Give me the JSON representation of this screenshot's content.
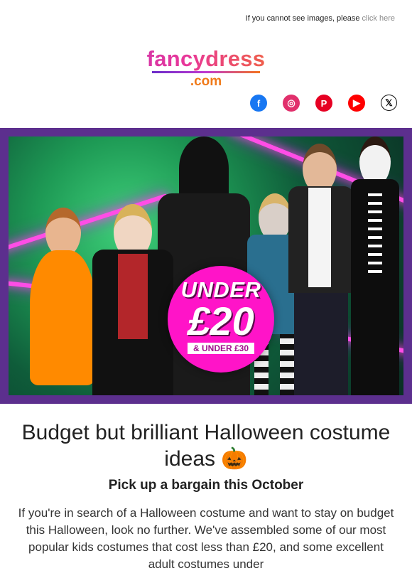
{
  "preheader": {
    "text": "If you cannot see images, please",
    "link": "click here"
  },
  "logo": {
    "main": "fancydress",
    "sub": ".com"
  },
  "social": [
    {
      "name": "facebook",
      "glyph": "f"
    },
    {
      "name": "instagram",
      "glyph": "◎"
    },
    {
      "name": "pinterest",
      "glyph": "P"
    },
    {
      "name": "youtube",
      "glyph": "▶"
    },
    {
      "name": "x",
      "glyph": "𝕏"
    }
  ],
  "hero": {
    "badge_line1": "UNDER",
    "badge_line2": "£20",
    "badge_line3": "& UNDER £30"
  },
  "content": {
    "headline": "Budget but brilliant Halloween costume ideas 🎃",
    "subhead": "Pick up a bargain this October",
    "body": "If you're in search of a Halloween costume and want to stay on budget this Halloween, look no further. We've assembled some of our most popular kids costumes that cost less than £20, and some excellent adult costumes under"
  },
  "colors": {
    "frame": "#5c2f8e",
    "badge": "#ff14c8",
    "neon": "#ff4de6",
    "link": "#8a8a8a"
  }
}
